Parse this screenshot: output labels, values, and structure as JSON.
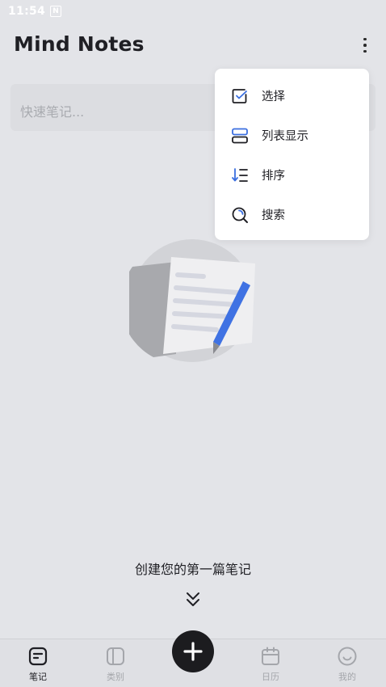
{
  "status_bar": {
    "time": "11:54",
    "notification_letter": "N"
  },
  "header": {
    "title": "Mind Notes"
  },
  "quick_note": {
    "placeholder": "快速笔记..."
  },
  "menu": {
    "items": [
      {
        "label": "选择",
        "icon": "select-checkbox-icon"
      },
      {
        "label": "列表显示",
        "icon": "list-view-icon"
      },
      {
        "label": "排序",
        "icon": "sort-icon"
      },
      {
        "label": "搜索",
        "icon": "search-icon"
      }
    ]
  },
  "empty_state": {
    "message": "创建您的第一篇笔记"
  },
  "tab_bar": {
    "tabs": [
      {
        "label": "笔记",
        "icon": "notes-icon",
        "active": true
      },
      {
        "label": "类别",
        "icon": "category-icon",
        "active": false
      },
      {
        "label": "日历",
        "icon": "calendar-icon",
        "active": false
      },
      {
        "label": "我的",
        "icon": "profile-icon",
        "active": false
      }
    ],
    "fab_icon": "plus-icon"
  },
  "colors": {
    "background": "#e3e4e8",
    "accent": "#3b6fe0",
    "dark": "#1c1c1f",
    "inactive": "#a4a6ab"
  }
}
